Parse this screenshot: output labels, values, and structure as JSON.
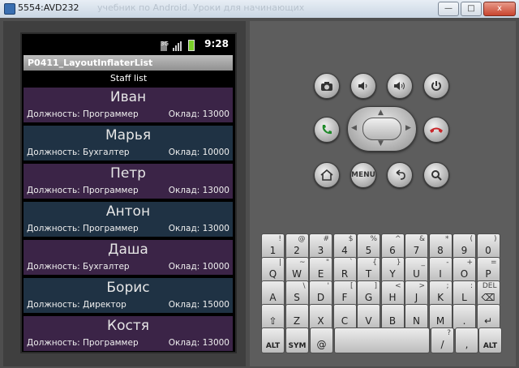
{
  "window": {
    "title": "5554:AVD232",
    "ghost_title": "учебник по Android. Уроки для начинающих",
    "btn_min": "—",
    "btn_max": "□",
    "btn_close": "x"
  },
  "status_bar": {
    "time": "9:28",
    "net": "3G"
  },
  "app": {
    "title": "P0411_LayoutInflaterList",
    "subtitle": "Staff list"
  },
  "list": [
    {
      "name": "Иван",
      "position": "Должность: Программер",
      "salary": "Оклад: 13000",
      "color": "#3b2447"
    },
    {
      "name": "Марья",
      "position": "Должность: Бухгалтер",
      "salary": "Оклад: 10000",
      "color": "#1f3244"
    },
    {
      "name": "Петр",
      "position": "Должность: Программер",
      "salary": "Оклад: 13000",
      "color": "#3b2447"
    },
    {
      "name": "Антон",
      "position": "Должность: Программер",
      "salary": "Оклад: 13000",
      "color": "#1f3244"
    },
    {
      "name": "Даша",
      "position": "Должность: Бухгалтер",
      "salary": "Оклад: 10000",
      "color": "#3b2447"
    },
    {
      "name": "Борис",
      "position": "Должность: Директор",
      "salary": "Оклад: 15000",
      "color": "#1f3244"
    },
    {
      "name": "Костя",
      "position": "Должность: Программер",
      "salary": "Оклад: 13000",
      "color": "#3b2447"
    }
  ],
  "hw_buttons": {
    "camera": "camera-icon",
    "vol_down": "volume-down-icon",
    "vol_up": "volume-up-icon",
    "power": "power-icon",
    "call": "call-icon",
    "end_call": "end-call-icon",
    "home": "home-icon",
    "menu": "MENU",
    "back": "back-icon",
    "search": "search-icon"
  },
  "keyboard": {
    "row1": [
      {
        "m": "1",
        "s": "!"
      },
      {
        "m": "2",
        "s": "@"
      },
      {
        "m": "3",
        "s": "#"
      },
      {
        "m": "4",
        "s": "$"
      },
      {
        "m": "5",
        "s": "%"
      },
      {
        "m": "6",
        "s": "^"
      },
      {
        "m": "7",
        "s": "&"
      },
      {
        "m": "8",
        "s": "*"
      },
      {
        "m": "9",
        "s": "("
      },
      {
        "m": "0",
        "s": ")"
      }
    ],
    "row2": [
      {
        "m": "Q",
        "s": "|"
      },
      {
        "m": "W",
        "s": "~"
      },
      {
        "m": "E",
        "s": "\""
      },
      {
        "m": "R",
        "s": "`"
      },
      {
        "m": "T",
        "s": "{"
      },
      {
        "m": "Y",
        "s": "}"
      },
      {
        "m": "U",
        "s": "_"
      },
      {
        "m": "I",
        "s": "-"
      },
      {
        "m": "O",
        "s": "+"
      },
      {
        "m": "P",
        "s": "="
      }
    ],
    "row3": [
      {
        "m": "A",
        "s": ""
      },
      {
        "m": "S",
        "s": "\\"
      },
      {
        "m": "D",
        "s": "'"
      },
      {
        "m": "F",
        "s": "["
      },
      {
        "m": "G",
        "s": "]"
      },
      {
        "m": "H",
        "s": "<"
      },
      {
        "m": "J",
        "s": ">"
      },
      {
        "m": "K",
        "s": ";"
      },
      {
        "m": "L",
        "s": ":"
      },
      {
        "m": "⌫",
        "s": "DEL"
      }
    ],
    "row4": [
      {
        "m": "⇧",
        "s": ""
      },
      {
        "m": "Z",
        "s": ""
      },
      {
        "m": "X",
        "s": ""
      },
      {
        "m": "C",
        "s": ""
      },
      {
        "m": "V",
        "s": ""
      },
      {
        "m": "B",
        "s": ""
      },
      {
        "m": "N",
        "s": ""
      },
      {
        "m": "M",
        "s": ""
      },
      {
        "m": ".",
        "s": ""
      },
      {
        "m": "↵",
        "s": ""
      }
    ],
    "row5": {
      "alt_left": "ALT",
      "sym": "SYM",
      "at": "@",
      "space": "",
      "slash": "/",
      "question": "?",
      "comma": ",",
      "alt_right": "ALT"
    }
  }
}
